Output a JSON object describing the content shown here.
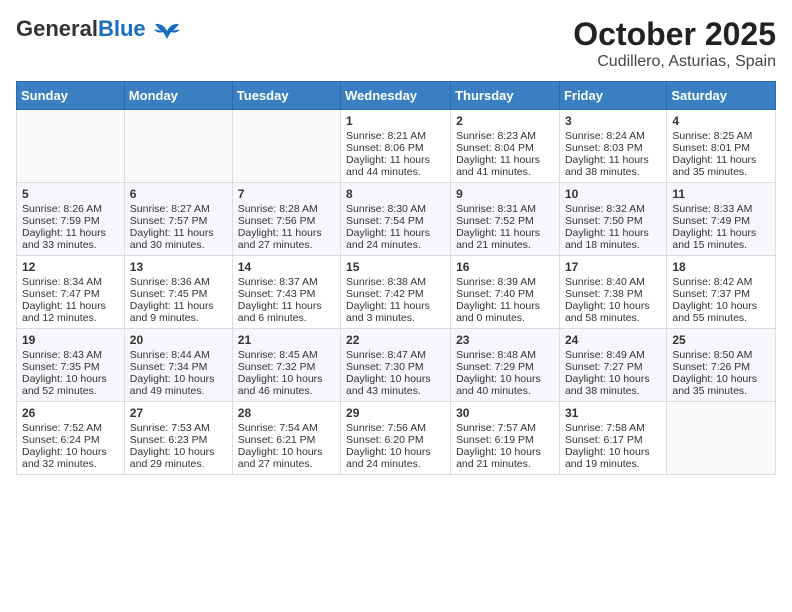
{
  "header": {
    "logo_general": "General",
    "logo_blue": "Blue",
    "title": "October 2025",
    "subtitle": "Cudillero, Asturias, Spain"
  },
  "days_of_week": [
    "Sunday",
    "Monday",
    "Tuesday",
    "Wednesday",
    "Thursday",
    "Friday",
    "Saturday"
  ],
  "weeks": [
    [
      {
        "day": "",
        "info": ""
      },
      {
        "day": "",
        "info": ""
      },
      {
        "day": "",
        "info": ""
      },
      {
        "day": "1",
        "info": "Sunrise: 8:21 AM\nSunset: 8:06 PM\nDaylight: 11 hours and 44 minutes."
      },
      {
        "day": "2",
        "info": "Sunrise: 8:23 AM\nSunset: 8:04 PM\nDaylight: 11 hours and 41 minutes."
      },
      {
        "day": "3",
        "info": "Sunrise: 8:24 AM\nSunset: 8:03 PM\nDaylight: 11 hours and 38 minutes."
      },
      {
        "day": "4",
        "info": "Sunrise: 8:25 AM\nSunset: 8:01 PM\nDaylight: 11 hours and 35 minutes."
      }
    ],
    [
      {
        "day": "5",
        "info": "Sunrise: 8:26 AM\nSunset: 7:59 PM\nDaylight: 11 hours and 33 minutes."
      },
      {
        "day": "6",
        "info": "Sunrise: 8:27 AM\nSunset: 7:57 PM\nDaylight: 11 hours and 30 minutes."
      },
      {
        "day": "7",
        "info": "Sunrise: 8:28 AM\nSunset: 7:56 PM\nDaylight: 11 hours and 27 minutes."
      },
      {
        "day": "8",
        "info": "Sunrise: 8:30 AM\nSunset: 7:54 PM\nDaylight: 11 hours and 24 minutes."
      },
      {
        "day": "9",
        "info": "Sunrise: 8:31 AM\nSunset: 7:52 PM\nDaylight: 11 hours and 21 minutes."
      },
      {
        "day": "10",
        "info": "Sunrise: 8:32 AM\nSunset: 7:50 PM\nDaylight: 11 hours and 18 minutes."
      },
      {
        "day": "11",
        "info": "Sunrise: 8:33 AM\nSunset: 7:49 PM\nDaylight: 11 hours and 15 minutes."
      }
    ],
    [
      {
        "day": "12",
        "info": "Sunrise: 8:34 AM\nSunset: 7:47 PM\nDaylight: 11 hours and 12 minutes."
      },
      {
        "day": "13",
        "info": "Sunrise: 8:36 AM\nSunset: 7:45 PM\nDaylight: 11 hours and 9 minutes."
      },
      {
        "day": "14",
        "info": "Sunrise: 8:37 AM\nSunset: 7:43 PM\nDaylight: 11 hours and 6 minutes."
      },
      {
        "day": "15",
        "info": "Sunrise: 8:38 AM\nSunset: 7:42 PM\nDaylight: 11 hours and 3 minutes."
      },
      {
        "day": "16",
        "info": "Sunrise: 8:39 AM\nSunset: 7:40 PM\nDaylight: 11 hours and 0 minutes."
      },
      {
        "day": "17",
        "info": "Sunrise: 8:40 AM\nSunset: 7:38 PM\nDaylight: 10 hours and 58 minutes."
      },
      {
        "day": "18",
        "info": "Sunrise: 8:42 AM\nSunset: 7:37 PM\nDaylight: 10 hours and 55 minutes."
      }
    ],
    [
      {
        "day": "19",
        "info": "Sunrise: 8:43 AM\nSunset: 7:35 PM\nDaylight: 10 hours and 52 minutes."
      },
      {
        "day": "20",
        "info": "Sunrise: 8:44 AM\nSunset: 7:34 PM\nDaylight: 10 hours and 49 minutes."
      },
      {
        "day": "21",
        "info": "Sunrise: 8:45 AM\nSunset: 7:32 PM\nDaylight: 10 hours and 46 minutes."
      },
      {
        "day": "22",
        "info": "Sunrise: 8:47 AM\nSunset: 7:30 PM\nDaylight: 10 hours and 43 minutes."
      },
      {
        "day": "23",
        "info": "Sunrise: 8:48 AM\nSunset: 7:29 PM\nDaylight: 10 hours and 40 minutes."
      },
      {
        "day": "24",
        "info": "Sunrise: 8:49 AM\nSunset: 7:27 PM\nDaylight: 10 hours and 38 minutes."
      },
      {
        "day": "25",
        "info": "Sunrise: 8:50 AM\nSunset: 7:26 PM\nDaylight: 10 hours and 35 minutes."
      }
    ],
    [
      {
        "day": "26",
        "info": "Sunrise: 7:52 AM\nSunset: 6:24 PM\nDaylight: 10 hours and 32 minutes."
      },
      {
        "day": "27",
        "info": "Sunrise: 7:53 AM\nSunset: 6:23 PM\nDaylight: 10 hours and 29 minutes."
      },
      {
        "day": "28",
        "info": "Sunrise: 7:54 AM\nSunset: 6:21 PM\nDaylight: 10 hours and 27 minutes."
      },
      {
        "day": "29",
        "info": "Sunrise: 7:56 AM\nSunset: 6:20 PM\nDaylight: 10 hours and 24 minutes."
      },
      {
        "day": "30",
        "info": "Sunrise: 7:57 AM\nSunset: 6:19 PM\nDaylight: 10 hours and 21 minutes."
      },
      {
        "day": "31",
        "info": "Sunrise: 7:58 AM\nSunset: 6:17 PM\nDaylight: 10 hours and 19 minutes."
      },
      {
        "day": "",
        "info": ""
      }
    ]
  ]
}
